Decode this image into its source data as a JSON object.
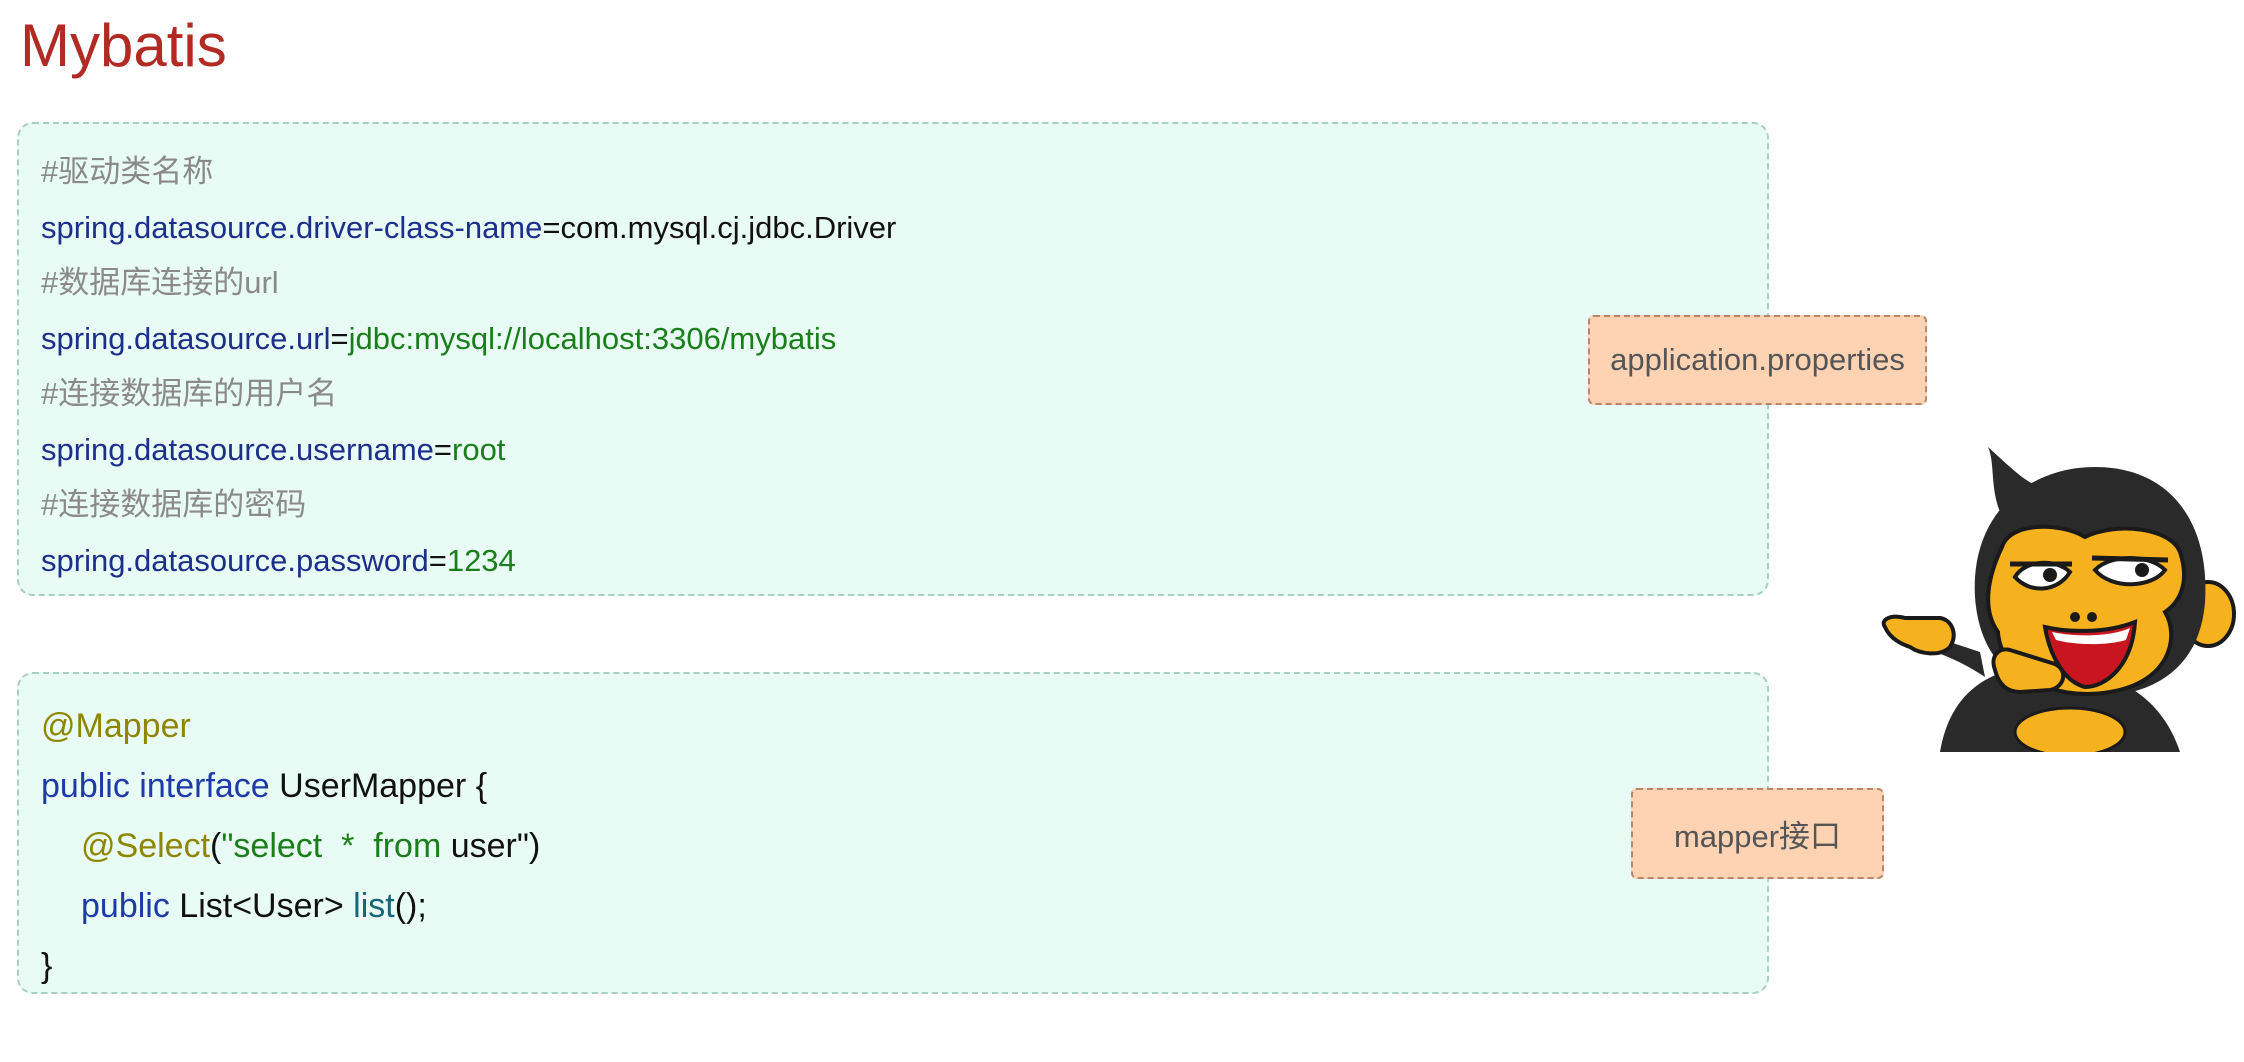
{
  "page": {
    "title": "Mybatis"
  },
  "properties_block": {
    "lines": [
      {
        "comment": "#驱动类名称"
      },
      {
        "key": "spring.datasource.driver-class-name",
        "sep": "=",
        "value": "com.mysql.cj.jdbc.Driver"
      },
      {
        "comment": "#数据库连接的url"
      },
      {
        "key": "spring.datasource.url",
        "sep": "=",
        "value": "jdbc:mysql://localhost:3306/mybatis"
      },
      {
        "comment": "#连接数据库的用户名"
      },
      {
        "key": "spring.datasource.username",
        "sep": "=",
        "value": "root"
      },
      {
        "comment": "#连接数据库的密码"
      },
      {
        "key": "spring.datasource.password",
        "sep": "=",
        "value": "1234"
      }
    ],
    "label": "application.properties"
  },
  "mapper_block": {
    "annotation": "@Mapper",
    "decl_public": "public",
    "decl_interface": "interface",
    "decl_name": "UserMapper",
    "decl_brace": "{",
    "select_annotation": "@Select",
    "select_open": "(",
    "select_quote_open": "\"select",
    "select_star": "*",
    "select_from": "from",
    "select_table": "user",
    "select_close": "\")",
    "method_public": "public",
    "method_return": "List<User>",
    "method_name": "list",
    "method_tail": "();",
    "close_brace": "}",
    "label": "mapper接口"
  },
  "colors": {
    "title": "#b22a24",
    "code_background": "#e8fbf4",
    "label_background": "#fdd3b4"
  },
  "icons": {
    "mascot": "pointing-monkey-mascot"
  }
}
